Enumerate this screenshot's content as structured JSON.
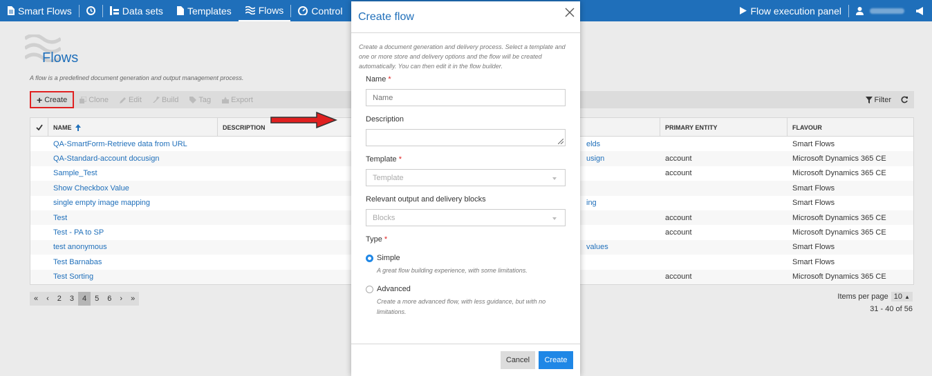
{
  "nav": {
    "brand": "Smart Flows",
    "items": [
      "Data sets",
      "Templates",
      "Flows",
      "Control"
    ],
    "execution_panel": "Flow execution panel"
  },
  "page": {
    "title": "Flows",
    "description": "A flow is a predefined document generation and output management process."
  },
  "toolbar": {
    "create": "Create",
    "clone": "Clone",
    "edit": "Edit",
    "build": "Build",
    "tag": "Tag",
    "export": "Export",
    "filter": "Filter"
  },
  "table": {
    "columns": [
      "NAME",
      "DESCRIPTION",
      "PRIMARY ENTITY",
      "FLAVOUR"
    ],
    "rows": [
      {
        "name": "QA-SmartForm-Retrieve data from URL",
        "desc_tail": "elds",
        "entity": "",
        "flavour": "Smart Flows"
      },
      {
        "name": "QA-Standard-account docusign",
        "desc_tail": "usign",
        "entity": "account",
        "flavour": "Microsoft Dynamics 365 CE"
      },
      {
        "name": "Sample_Test",
        "desc_tail": "",
        "entity": "account",
        "flavour": "Microsoft Dynamics 365 CE"
      },
      {
        "name": "Show Checkbox Value",
        "desc_tail": "",
        "entity": "",
        "flavour": "Smart Flows"
      },
      {
        "name": "single empty image mapping",
        "desc_tail": "ing",
        "entity": "",
        "flavour": "Smart Flows"
      },
      {
        "name": "Test",
        "desc_tail": "",
        "entity": "account",
        "flavour": "Microsoft Dynamics 365 CE"
      },
      {
        "name": "Test - PA to SP",
        "desc_tail": "",
        "entity": "account",
        "flavour": "Microsoft Dynamics 365 CE"
      },
      {
        "name": "test anonymous",
        "desc_tail": "values",
        "entity": "",
        "flavour": "Smart Flows"
      },
      {
        "name": "Test Barnabas",
        "desc_tail": "",
        "entity": "",
        "flavour": "Smart Flows"
      },
      {
        "name": "Test Sorting",
        "desc_tail": "",
        "entity": "account",
        "flavour": "Microsoft Dynamics 365 CE"
      }
    ]
  },
  "pager": {
    "first": "«",
    "prev": "‹",
    "pages": [
      "2",
      "3",
      "4",
      "5",
      "6"
    ],
    "current": "4",
    "next": "›",
    "last": "»",
    "items_per_page_label": "Items per page",
    "items_per_page": "10",
    "range": "31 - 40 of 56"
  },
  "modal": {
    "title": "Create flow",
    "intro": "Create a document generation and delivery process. Select a template and one or more store and delivery options and the flow will be created automatically. You can then edit it in the flow builder.",
    "name_label": "Name",
    "name_placeholder": "Name",
    "description_label": "Description",
    "template_label": "Template",
    "template_placeholder": "Template",
    "blocks_label": "Relevant output and delivery blocks",
    "blocks_placeholder": "Blocks",
    "type_label": "Type",
    "simple_label": "Simple",
    "simple_help": "A great flow building experience, with some limitations.",
    "advanced_label": "Advanced",
    "advanced_help": "Create a more advanced flow, with less guidance, but with no limitations.",
    "cancel": "Cancel",
    "create": "Create"
  },
  "colors": {
    "brand": "#1f6fba",
    "accent": "#1f87e6",
    "annotation": "#e02020"
  }
}
